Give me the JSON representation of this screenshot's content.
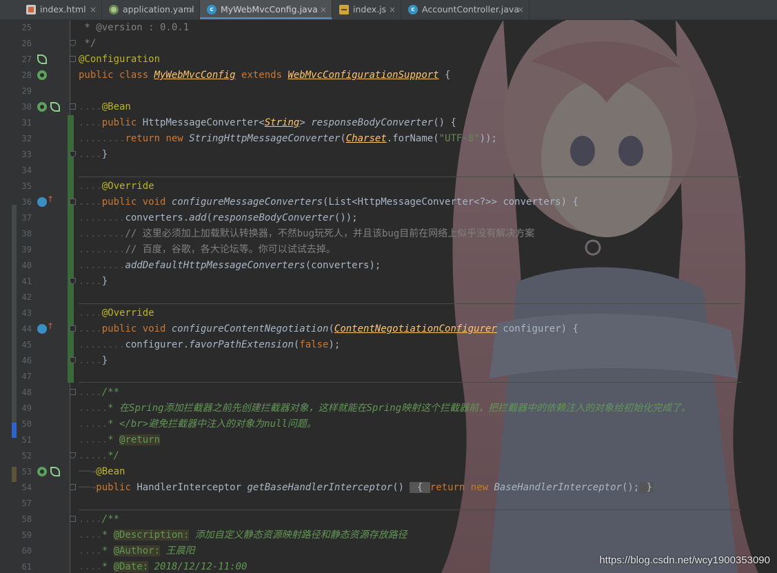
{
  "tabs": [
    {
      "label": "index.html",
      "icon": "html-file-icon",
      "close": "×"
    },
    {
      "label": "application.yaml",
      "icon": "yaml-file-icon",
      "close": "×"
    },
    {
      "label": "MyWebMvcConfig.java",
      "icon": "java-class-icon",
      "close": "×",
      "active": true
    },
    {
      "label": "index.js",
      "icon": "js-file-icon",
      "close": "×"
    },
    {
      "label": "AccountController.java",
      "icon": "java-class-icon",
      "close": "×"
    }
  ],
  "editor": {
    "lines": [
      {
        "n": "25",
        "segs": [
          [
            "cmt",
            " * @version : 0.0.1"
          ]
        ]
      },
      {
        "n": "26",
        "segs": [
          [
            "cmt",
            " */"
          ]
        ]
      },
      {
        "n": "27",
        "segs": [
          [
            "ann",
            "@Configuration"
          ]
        ]
      },
      {
        "n": "28",
        "segs": [
          [
            "kw",
            "public class "
          ],
          [
            "cls",
            "MyWebMvcConfig"
          ],
          [
            "kw",
            " extends "
          ],
          [
            "cls",
            "WebMvcConfigurationSupport"
          ],
          [
            "txt",
            " {"
          ]
        ]
      },
      {
        "n": "29",
        "segs": []
      },
      {
        "n": "30",
        "segs": [
          [
            "dots",
            "...."
          ],
          [
            "ann",
            "@Bean"
          ]
        ]
      },
      {
        "n": "31",
        "segs": [
          [
            "dots",
            "...."
          ],
          [
            "kw",
            "public "
          ],
          [
            "txt",
            "HttpMessageConverter<"
          ],
          [
            "cls",
            "String"
          ],
          [
            "txt",
            "> "
          ],
          [
            "it",
            "responseBodyConverter"
          ],
          [
            "txt",
            "() {"
          ]
        ]
      },
      {
        "n": "32",
        "segs": [
          [
            "dots",
            "........"
          ],
          [
            "kw",
            "return new "
          ],
          [
            "it",
            "StringHttpMessageConverter"
          ],
          [
            "txt",
            "("
          ],
          [
            "cls",
            "Charset"
          ],
          [
            "txt",
            ".forName("
          ],
          [
            "str",
            "\"UTF-8\""
          ],
          [
            "txt",
            "));"
          ]
        ]
      },
      {
        "n": "33",
        "segs": [
          [
            "dots",
            "...."
          ],
          [
            "txt",
            "}"
          ]
        ]
      },
      {
        "n": "34",
        "segs": []
      },
      {
        "n": "35",
        "segs": [
          [
            "dots",
            "...."
          ],
          [
            "ann",
            "@Override"
          ]
        ]
      },
      {
        "n": "36",
        "segs": [
          [
            "dots",
            "...."
          ],
          [
            "kw",
            "public void "
          ],
          [
            "it",
            "configureMessageConverters"
          ],
          [
            "txt",
            "(List<HttpMessageConverter<?>> converters) {"
          ]
        ]
      },
      {
        "n": "37",
        "segs": [
          [
            "dots",
            "........"
          ],
          [
            "txt",
            "converters."
          ],
          [
            "it",
            "add"
          ],
          [
            "txt",
            "("
          ],
          [
            "it",
            "responseBodyConverter"
          ],
          [
            "txt",
            "());"
          ]
        ]
      },
      {
        "n": "38",
        "segs": [
          [
            "dots",
            "........"
          ],
          [
            "cmt",
            "// 这里必须加上加载默认转换器，不然bug玩死人，并且该bug目前在网络上似乎没有解决方案"
          ]
        ]
      },
      {
        "n": "39",
        "segs": [
          [
            "dots",
            "........"
          ],
          [
            "cmt",
            "// 百度，谷歌，各大论坛等。你可以试试去掉。"
          ]
        ]
      },
      {
        "n": "40",
        "segs": [
          [
            "dots",
            "........"
          ],
          [
            "it",
            "addDefaultHttpMessageConverters"
          ],
          [
            "txt",
            "(converters);"
          ]
        ]
      },
      {
        "n": "41",
        "segs": [
          [
            "dots",
            "...."
          ],
          [
            "txt",
            "}"
          ]
        ]
      },
      {
        "n": "42",
        "segs": []
      },
      {
        "n": "43",
        "segs": [
          [
            "dots",
            "...."
          ],
          [
            "ann",
            "@Override"
          ]
        ]
      },
      {
        "n": "44",
        "segs": [
          [
            "dots",
            "...."
          ],
          [
            "kw",
            "public void "
          ],
          [
            "it",
            "configureContentNegotiation"
          ],
          [
            "txt",
            "("
          ],
          [
            "cls",
            "ContentNegotiationConfigurer"
          ],
          [
            "txt",
            " configurer) {"
          ]
        ]
      },
      {
        "n": "45",
        "segs": [
          [
            "dots",
            "........"
          ],
          [
            "txt",
            "configurer."
          ],
          [
            "it",
            "favorPathExtension"
          ],
          [
            "txt",
            "("
          ],
          [
            "kw",
            "false"
          ],
          [
            "txt",
            ");"
          ]
        ]
      },
      {
        "n": "46",
        "segs": [
          [
            "dots",
            "...."
          ],
          [
            "txt",
            "}"
          ]
        ]
      },
      {
        "n": "47",
        "segs": []
      },
      {
        "n": "48",
        "segs": [
          [
            "dots",
            "...."
          ],
          [
            "doc",
            "/**"
          ]
        ]
      },
      {
        "n": "49",
        "segs": [
          [
            "dots",
            "....."
          ],
          [
            "doc",
            "* 在Spring添加拦截器之前先创建拦截器对象，这样就能在Spring映射这个拦截器前，把拦截器中的依赖注入的对象给初始化完成了。"
          ]
        ]
      },
      {
        "n": "50",
        "segs": [
          [
            "dots",
            "....."
          ],
          [
            "doc",
            "* </br>避免拦截器中注入的对象为null问题。"
          ]
        ]
      },
      {
        "n": "51",
        "segs": [
          [
            "dots",
            "....."
          ],
          [
            "doc",
            "* "
          ],
          [
            "tag",
            "@return"
          ]
        ]
      },
      {
        "n": "52",
        "segs": [
          [
            "dots",
            "....."
          ],
          [
            "doc",
            "*/"
          ]
        ]
      },
      {
        "n": "53",
        "segs": [
          [
            "dots",
            "──→"
          ],
          [
            "ann",
            "@Bean"
          ]
        ]
      },
      {
        "n": "54",
        "segs": [
          [
            "dots",
            "──→"
          ],
          [
            "kw",
            "public "
          ],
          [
            "txt",
            "HandlerInterceptor "
          ],
          [
            "it",
            "getBaseHandlerInterceptor"
          ],
          [
            "txt",
            "() "
          ],
          [
            "fold",
            " { "
          ],
          [
            "kw",
            "return new "
          ],
          [
            "it",
            "BaseHandlerInterceptor"
          ],
          [
            "txt",
            "();"
          ],
          [
            "fold",
            " }"
          ]
        ]
      },
      {
        "n": "57",
        "segs": []
      },
      {
        "n": "58",
        "segs": [
          [
            "dots",
            "...."
          ],
          [
            "doc",
            "/**"
          ]
        ]
      },
      {
        "n": "59",
        "segs": [
          [
            "dots",
            "...."
          ],
          [
            "doc",
            "* "
          ],
          [
            "tag",
            "@Description:"
          ],
          [
            "doc",
            " 添加自定义静态资源映射路径和静态资源存放路径"
          ]
        ]
      },
      {
        "n": "60",
        "segs": [
          [
            "dots",
            "...."
          ],
          [
            "doc",
            "* "
          ],
          [
            "tag",
            "@Author:"
          ],
          [
            "doc",
            " 王晨阳"
          ]
        ]
      },
      {
        "n": "61",
        "segs": [
          [
            "dots",
            "...."
          ],
          [
            "doc",
            "* "
          ],
          [
            "tag",
            "@Date:"
          ],
          [
            "doc",
            " 2018/12/12-11:00"
          ]
        ]
      }
    ]
  },
  "watermark": "https://blog.csdn.net/wcy1900353090"
}
